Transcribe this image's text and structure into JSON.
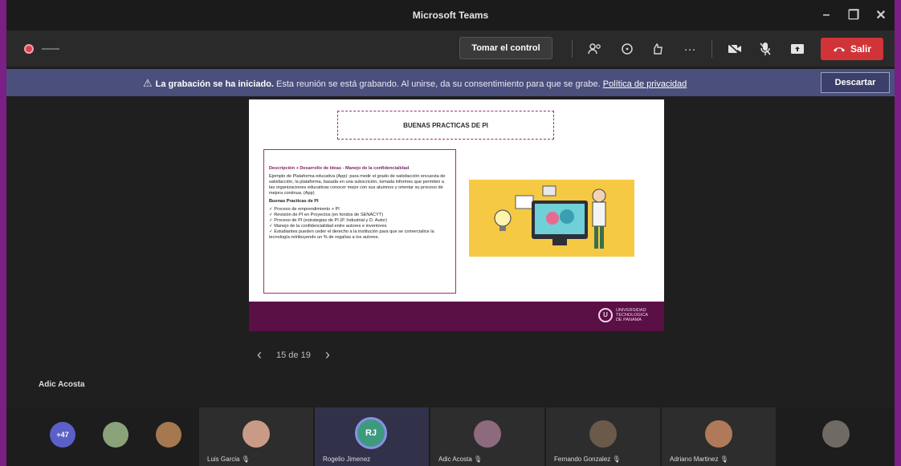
{
  "window": {
    "title": "Microsoft Teams"
  },
  "toolbar": {
    "take_control_label": "Tomar el control",
    "more_label": "···",
    "leave_label": "Salir"
  },
  "banner": {
    "bold": "La grabación se ha iniciado.",
    "text": " Esta reunión se está grabando. Al unirse, da su consentimiento para que se grabe. ",
    "link": "Política de privacidad",
    "dismiss_label": "Descartar"
  },
  "slide": {
    "title": "BUENAS PRACTICAS DE PI",
    "desc_heading": "Descripción + Desarrollo de Ideas - Manejo de la confidencialidad",
    "desc_body": "Ejemplo de Plataforma educativa (App): para medir el grado de satisfacción encuesta de satisfacción, la plataforma, basada en una subscrición, tomada informes que permiten a las organizaciones educativas conocer mejor con sus alumnos y orientar su proceso de mejora continua. (App)",
    "bp_heading": "Buenas Practicas de PI",
    "bullets": [
      "✓ Proceso de emprendimiento + PI",
      "✓ Revisión de PI en Proyectos (en fondos de SENACYT)",
      "✓ Proceso de PI (estrategias de PI (P. Industrial y D. Autor)",
      "✓ Manejo de la confidencialidad entre autores e inventores",
      "✓ Estudiantes pueden ceder el derecho a la institución para que se comercialice la tecnología retribuyendo un % de regalías a los autores."
    ],
    "logo_text": [
      "UNIVERSIDAD",
      "TECNOLOGICA",
      "DE PANAMA"
    ]
  },
  "pager": {
    "prev": "‹",
    "label": "15 de 19",
    "next": "›"
  },
  "presenter": {
    "name": "Adic Acosta"
  },
  "participants": {
    "overflow_badge": "+47",
    "tiles": [
      {
        "name": "Luis Garcia"
      },
      {
        "name": "Rogelio Jimenez",
        "initials": "RJ"
      },
      {
        "name": "Adic Acosta"
      },
      {
        "name": "Fernando Gonzalez"
      },
      {
        "name": "Adriano Martinez"
      },
      {
        "name": ""
      }
    ]
  }
}
